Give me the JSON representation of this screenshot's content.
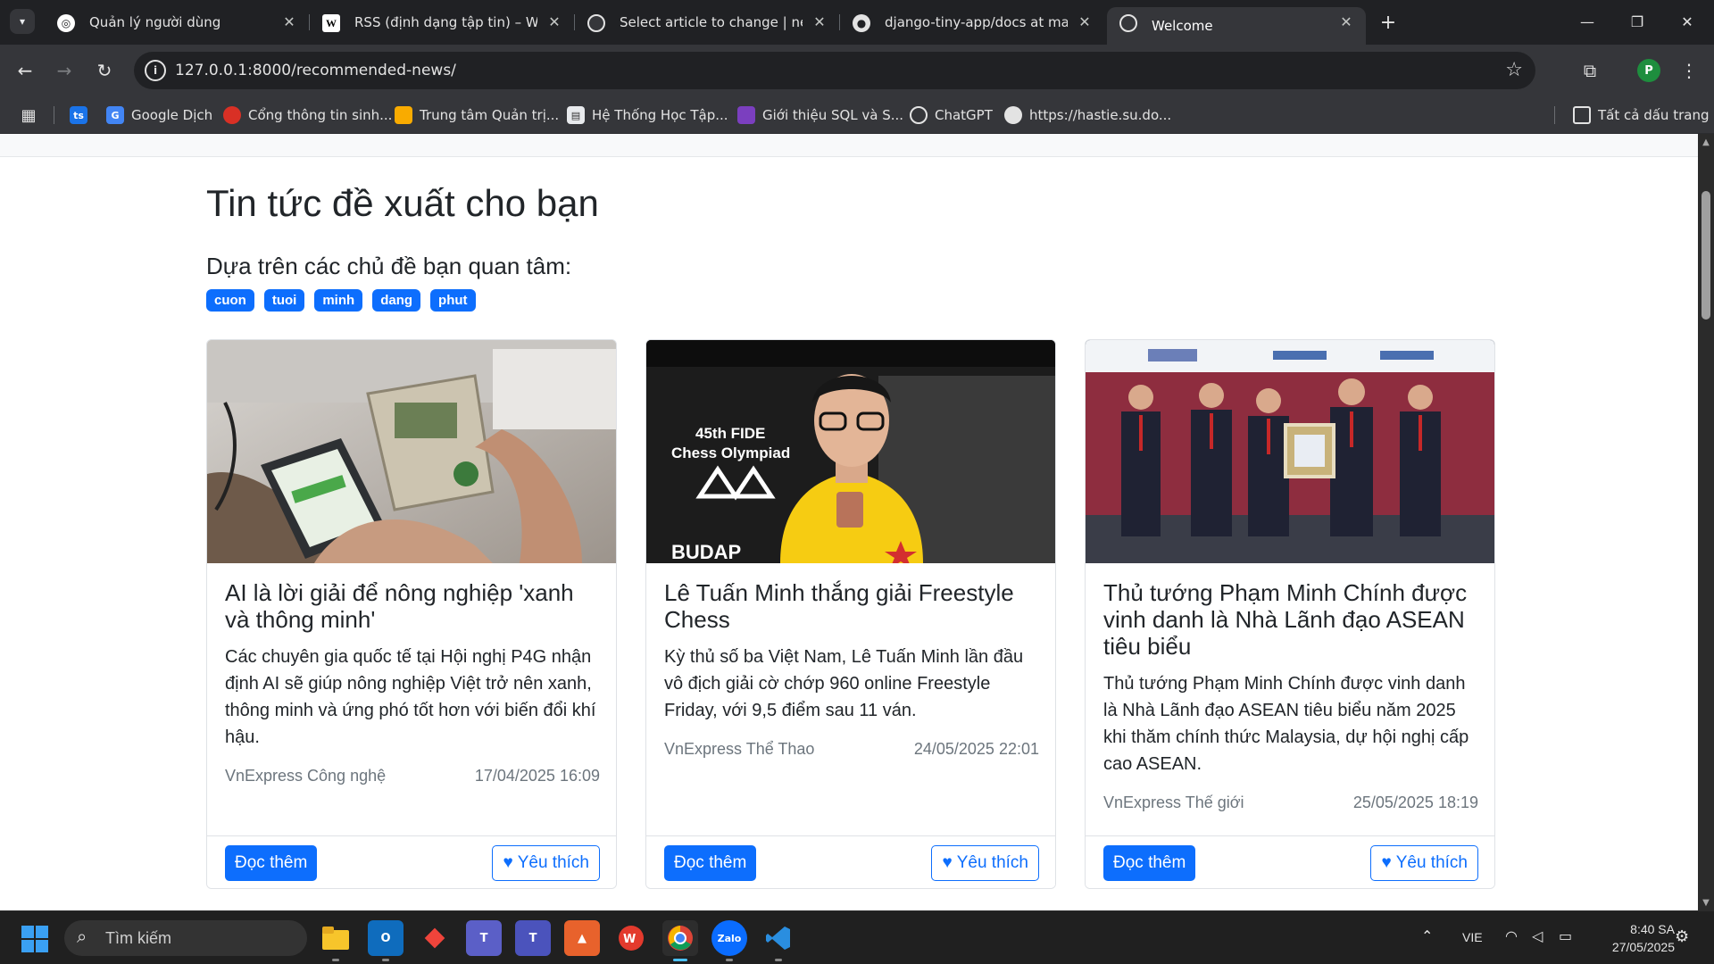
{
  "browser": {
    "tabs": [
      {
        "title": "Quản lý người dùng",
        "icon": "globe-icon",
        "active": false
      },
      {
        "title": "RSS (định dạng tập tin) – Wikip",
        "icon": "wikipedia-icon",
        "active": false
      },
      {
        "title": "Select article to change | news a",
        "icon": "globe-icon",
        "active": false
      },
      {
        "title": "django-tiny-app/docs at main ·",
        "icon": "github-icon",
        "active": false
      },
      {
        "title": "Welcome",
        "icon": "globe-icon",
        "active": true
      }
    ],
    "new_tab_icon": "plus-icon",
    "url": "127.0.0.1:8000/recommended-news/",
    "profile_initial": "P",
    "bookmarks": [
      {
        "label": "",
        "icon": "ts-icon"
      },
      {
        "label": "Google Dịch",
        "icon": "google-translate-icon"
      },
      {
        "label": "Cổng thông tin sinh...",
        "icon": "portal-icon"
      },
      {
        "label": "Trung tâm Quản trị...",
        "icon": "admin-icon"
      },
      {
        "label": "Hệ Thống Học Tập...",
        "icon": "lms-icon"
      },
      {
        "label": "Giới thiệu SQL và S...",
        "icon": "sql-icon"
      },
      {
        "label": "ChatGPT",
        "icon": "chatgpt-icon"
      },
      {
        "label": "https://hastie.su.do...",
        "icon": "globe-icon"
      }
    ],
    "all_bookmarks_label": "Tất cả dấu trang"
  },
  "page": {
    "title": "Tin tức đề xuất cho bạn",
    "subtitle": "Dựa trên các chủ đề bạn quan tâm:",
    "tags": [
      "cuon",
      "tuoi",
      "minh",
      "dang",
      "phut"
    ],
    "cards": [
      {
        "title": "AI là lời giải để nông nghiệp 'xanh và thông minh'",
        "summary": "Các chuyên gia quốc tế tại Hội nghị P4G nhận định AI sẽ giúp nông nghiệp Việt trở nên xanh, thông minh và ứng phó tốt hơn với biến đổi khí hậu.",
        "source": "VnExpress Công nghệ",
        "date": "17/04/2025 16:09",
        "read_more": "Đọc thêm",
        "like": "Yêu thích"
      },
      {
        "title": "Lê Tuấn Minh thắng giải Freestyle Chess",
        "summary": "Kỳ thủ số ba Việt Nam, Lê Tuấn Minh lần đầu vô địch giải cờ chớp 960 online Freestyle Friday, với 9,5 điểm sau 11 ván.",
        "source": "VnExpress Thể Thao",
        "date": "24/05/2025 22:01",
        "read_more": "Đọc thêm",
        "like": "Yêu thích",
        "image_text": [
          "45th FIDE",
          "Chess Olympiad",
          "BUDAP"
        ]
      },
      {
        "title": "Thủ tướng Phạm Minh Chính được vinh danh là Nhà Lãnh đạo ASEAN tiêu biểu",
        "summary": "Thủ tướng Phạm Minh Chính được vinh danh là Nhà Lãnh đạo ASEAN tiêu biểu năm 2025 khi thăm chính thức Malaysia, dự hội nghị cấp cao ASEAN.",
        "source": "VnExpress Thế giới",
        "date": "25/05/2025 18:19",
        "read_more": "Đọc thêm",
        "like": "Yêu thích"
      }
    ]
  },
  "taskbar": {
    "search_placeholder": "Tìm kiếm",
    "apps": [
      "file-explorer-icon",
      "outlook-icon",
      "anydesk-icon",
      "teams-icon",
      "teams-work-icon",
      "ms-office-icon",
      "wps-icon",
      "chrome-icon",
      "zalo-icon",
      "vscode-icon"
    ],
    "zalo_label": "Zalo",
    "language": "VIE",
    "time": "8:40 SA",
    "date": "27/05/2025"
  },
  "colors": {
    "primary": "#0d6efd",
    "chrome_dark": "#202124",
    "chrome_toolbar": "#35363a",
    "taskbar": "#202020"
  }
}
